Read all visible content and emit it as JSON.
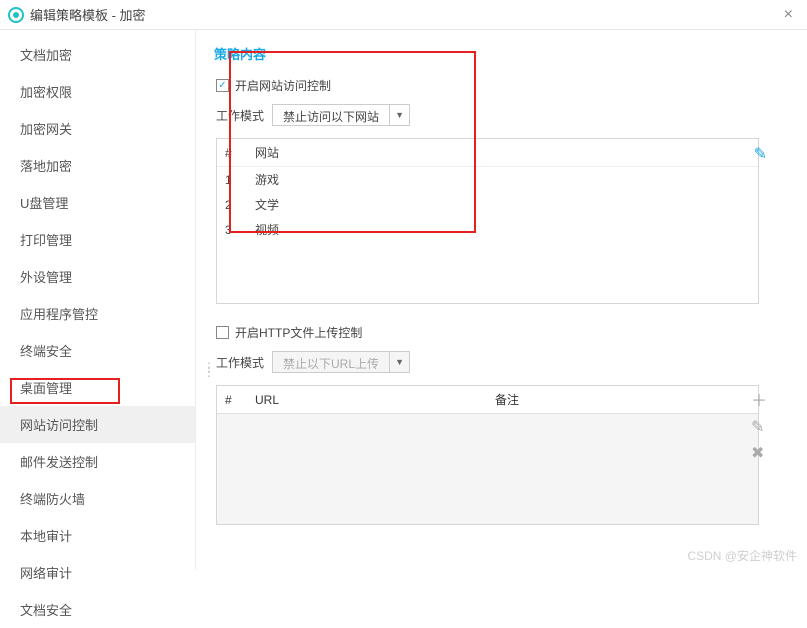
{
  "titlebar": {
    "title": "编辑策略模板 - 加密"
  },
  "sidebar": {
    "items": [
      {
        "label": "文档加密"
      },
      {
        "label": "加密权限"
      },
      {
        "label": "加密网关"
      },
      {
        "label": "落地加密"
      },
      {
        "label": "U盘管理"
      },
      {
        "label": "打印管理"
      },
      {
        "label": "外设管理"
      },
      {
        "label": "应用程序管控"
      },
      {
        "label": "终端安全"
      },
      {
        "label": "桌面管理"
      },
      {
        "label": "网站访问控制"
      },
      {
        "label": "邮件发送控制"
      },
      {
        "label": "终端防火墙"
      },
      {
        "label": "本地审计"
      },
      {
        "label": "网络审计"
      },
      {
        "label": "文档安全"
      }
    ],
    "active_index": 10
  },
  "content": {
    "section_title": "策略内容",
    "web_access": {
      "checkbox_label": "开启网站访问控制",
      "checked": true,
      "mode_label": "工作模式",
      "mode_value": "禁止访问以下网站",
      "table": {
        "headers": {
          "idx": "#",
          "site": "网站"
        },
        "rows": [
          {
            "idx": "1",
            "site": "游戏"
          },
          {
            "idx": "2",
            "site": "文学"
          },
          {
            "idx": "3",
            "site": "视频"
          }
        ]
      }
    },
    "http_upload": {
      "checkbox_label": "开启HTTP文件上传控制",
      "checked": false,
      "mode_label": "工作模式",
      "mode_value": "禁止以下URL上传",
      "table": {
        "headers": {
          "idx": "#",
          "url": "URL",
          "note": "备注"
        }
      }
    }
  },
  "watermark": "CSDN @安企神软件"
}
